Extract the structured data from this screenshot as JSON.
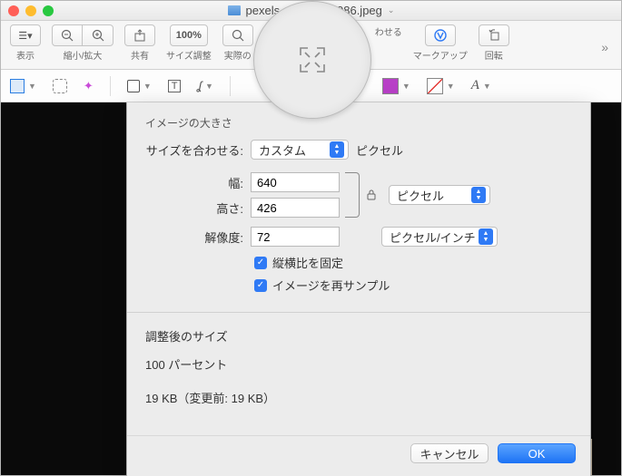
{
  "titlebar": {
    "filename": "pexels-photo-236086.jpeg"
  },
  "toolbar": {
    "view": "表示",
    "zoom": "縮小/拡大",
    "share": "共有",
    "size_pct": "100%",
    "size_adjust": "サイズ調整",
    "actual": "実際の",
    "fit": "わせる",
    "markup": "マークアップ",
    "rotate": "回転"
  },
  "dialog": {
    "section_title": "イメージの大きさ",
    "fit_label": "サイズを合わせる:",
    "fit_value": "カスタム",
    "fit_unit": "ピクセル",
    "width_label": "幅:",
    "width_value": "640",
    "height_label": "高さ:",
    "height_value": "426",
    "wh_unit": "ピクセル",
    "res_label": "解像度:",
    "res_value": "72",
    "res_unit": "ピクセル/インチ",
    "lock_ratio": "縦横比を固定",
    "resample": "イメージを再サンプル",
    "result_title": "調整後のサイズ",
    "result_percent": "100 パーセント",
    "result_size": "19 KB（変更前: 19 KB）",
    "cancel": "キャンセル",
    "ok": "OK"
  }
}
